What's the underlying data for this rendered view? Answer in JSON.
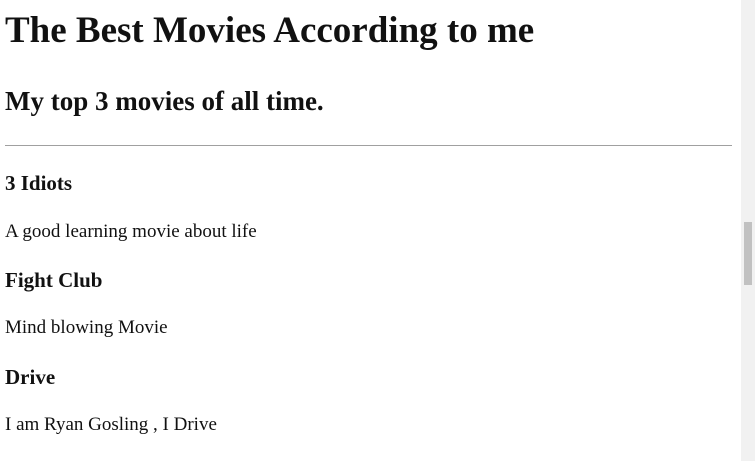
{
  "page": {
    "heading": "The Best Movies According to me",
    "subheading": "My top 3 movies of all time."
  },
  "movies": [
    {
      "title": "3 Idiots",
      "description": "A good learning movie about life"
    },
    {
      "title": "Fight Club",
      "description": "Mind blowing Movie"
    },
    {
      "title": "Drive",
      "description": "I am Ryan Gosling , I Drive"
    }
  ],
  "colors": {
    "text": "#111111",
    "divider": "#a0a0a0",
    "scrollbar_track": "#f1f1f1",
    "scrollbar_thumb": "#c1c1c1"
  },
  "scroll": {
    "position_fraction": 0.48
  }
}
